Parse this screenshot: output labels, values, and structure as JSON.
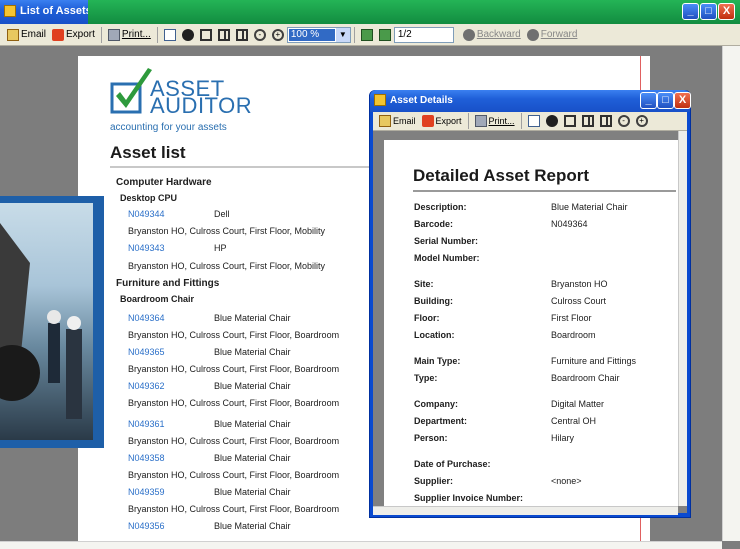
{
  "main_window": {
    "title": "List of Assets",
    "controls": {
      "minimize": "_",
      "maximize": "□",
      "close": "X"
    }
  },
  "toolbar": {
    "email": "Email",
    "export": "Export",
    "print": "Print...",
    "zoom": "100 %",
    "page": "1/2",
    "backward": "Backward",
    "forward": "Forward"
  },
  "logo": {
    "line1": "ASSET",
    "line2": "AUDITOR",
    "tagline": "accounting for your assets"
  },
  "report": {
    "heading": "Asset list",
    "rows": [
      {
        "kind": "group",
        "text": "Computer Hardware"
      },
      {
        "kind": "sub",
        "text": "Desktop CPU"
      },
      {
        "kind": "item",
        "code": "N049344",
        "desc": "Dell"
      },
      {
        "kind": "loc",
        "text": "Bryanston HO, Culross Court, First Floor, Mobility"
      },
      {
        "kind": "item",
        "code": "N049343",
        "desc": "HP"
      },
      {
        "kind": "loc",
        "text": "Bryanston HO, Culross Court, First Floor, Mobility"
      },
      {
        "kind": "group",
        "text": "Furniture and Fittings"
      },
      {
        "kind": "sub",
        "text": "Boardroom Chair"
      },
      {
        "kind": "item",
        "code": "N049364",
        "desc": "Blue Material Chair"
      },
      {
        "kind": "loc",
        "text": "Bryanston HO, Culross Court, First Floor, Boardroom"
      },
      {
        "kind": "item",
        "code": "N049365",
        "desc": "Blue Material Chair"
      },
      {
        "kind": "loc",
        "text": "Bryanston HO, Culross Court, First Floor, Boardroom"
      },
      {
        "kind": "item",
        "code": "N049362",
        "desc": "Blue Material Chair"
      },
      {
        "kind": "loc",
        "text": "Bryanston HO, Culross Court, First Floor, Boardroom"
      },
      {
        "kind": "item",
        "code": "N049361",
        "desc": "Blue Material Chair"
      },
      {
        "kind": "loc",
        "text": "Bryanston HO, Culross Court, First Floor, Boardroom"
      },
      {
        "kind": "item",
        "code": "N049358",
        "desc": "Blue Material Chair"
      },
      {
        "kind": "loc",
        "text": "Bryanston HO, Culross Court, First Floor, Boardroom"
      },
      {
        "kind": "item",
        "code": "N049359",
        "desc": "Blue Material Chair"
      },
      {
        "kind": "loc",
        "text": "Bryanston HO, Culross Court, First Floor, Boardroom"
      },
      {
        "kind": "item",
        "code": "N049356",
        "desc": "Blue Material Chair"
      },
      {
        "kind": "loc",
        "text": "Bryanston HO, Culross Court, First Floor, Boardroom"
      }
    ]
  },
  "details": {
    "title": "Asset Details",
    "toolbar": {
      "email": "Email",
      "export": "Export",
      "print": "Print..."
    },
    "heading": "Detailed Asset Report",
    "fields": [
      {
        "label": "Description:",
        "value": "Blue Material Chair"
      },
      {
        "label": "Barcode:",
        "value": "N049364"
      },
      {
        "label": "Serial Number:",
        "value": ""
      },
      {
        "label": "Model Number:",
        "value": ""
      },
      {
        "label": "Site:",
        "value": "Bryanston HO"
      },
      {
        "label": "Building:",
        "value": "Culross Court"
      },
      {
        "label": "Floor:",
        "value": "First Floor"
      },
      {
        "label": "Location:",
        "value": "Boardroom"
      },
      {
        "label": "Main Type:",
        "value": "Furniture and Fittings"
      },
      {
        "label": "Type:",
        "value": "Boardroom Chair"
      },
      {
        "label": "Company:",
        "value": "Digital Matter"
      },
      {
        "label": "Department:",
        "value": "Central OH"
      },
      {
        "label": "Person:",
        "value": "Hilary"
      },
      {
        "label": "Date of Purchase:",
        "value": ""
      },
      {
        "label": "Supplier:",
        "value": "<none>"
      },
      {
        "label": "Supplier Invoice Number:",
        "value": ""
      }
    ]
  },
  "colors": {
    "accent_blue": "#1f5fd8",
    "link_blue": "#2a6fc8",
    "brand_green": "#1a9a4a"
  }
}
